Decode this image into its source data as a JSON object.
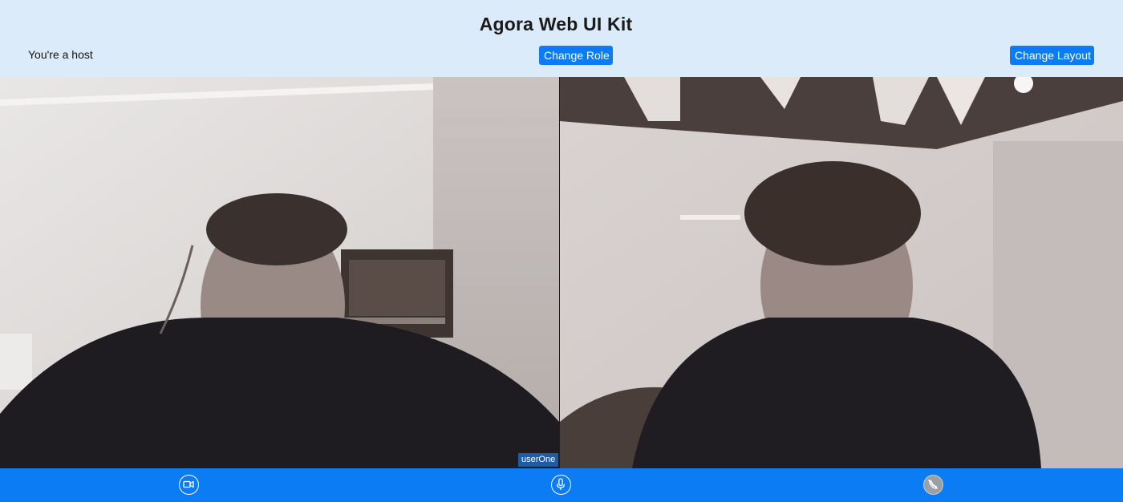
{
  "header": {
    "title": "Agora Web UI Kit",
    "role_text": "You're a host",
    "change_role_label": "Change Role",
    "change_layout_label": "Change Layout"
  },
  "videos": {
    "local_user_label": "userOne"
  },
  "controls": {
    "video_icon": "video-camera-icon",
    "mic_icon": "microphone-icon",
    "end_call_icon": "end-call-icon"
  },
  "colors": {
    "header_bg": "#dcebfa",
    "button_bg": "#0c7cf5",
    "control_bar_bg": "#0c7cf5"
  }
}
